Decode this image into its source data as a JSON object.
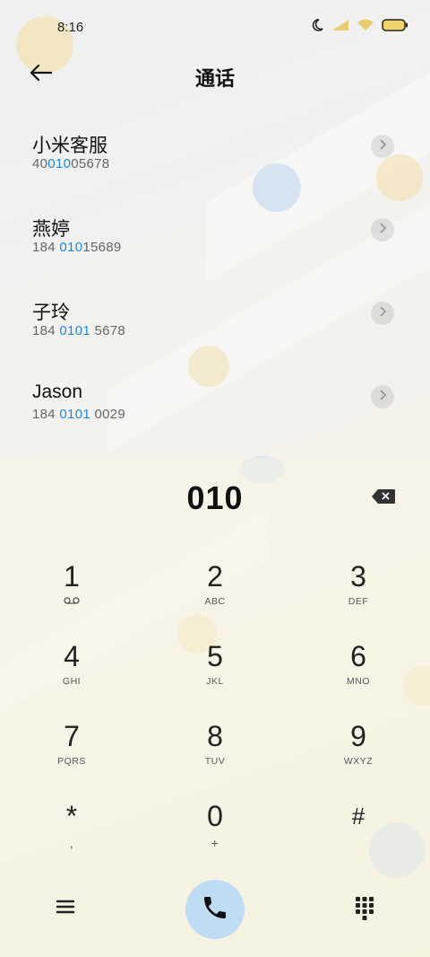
{
  "status_bar": {
    "time": "8:16"
  },
  "header": {
    "title": "通话"
  },
  "contacts": [
    {
      "name": "小米客服",
      "number_pre": "40",
      "number_hl": "010",
      "number_post": "05678"
    },
    {
      "name": "燕婷",
      "number_pre": "184 ",
      "number_hl": "010",
      "number_post": "15689"
    },
    {
      "name": "子玲",
      "number_pre": "184 ",
      "number_hl": "0101",
      "number_post": " 5678"
    },
    {
      "name": "Jason",
      "number_pre": "184 ",
      "number_hl": "0101",
      "number_post": " 0029"
    }
  ],
  "dialpad": {
    "entered_number": "010",
    "keys": [
      {
        "digit": "1",
        "letters": ""
      },
      {
        "digit": "2",
        "letters": "ABC"
      },
      {
        "digit": "3",
        "letters": "DEF"
      },
      {
        "digit": "4",
        "letters": "GHI"
      },
      {
        "digit": "5",
        "letters": "JKL"
      },
      {
        "digit": "6",
        "letters": "MNO"
      },
      {
        "digit": "7",
        "letters": "PQRS"
      },
      {
        "digit": "8",
        "letters": "TUV"
      },
      {
        "digit": "9",
        "letters": "WXYZ"
      },
      {
        "digit": "*",
        "letters": ","
      },
      {
        "digit": "0",
        "letters": "+"
      },
      {
        "digit": "#",
        "letters": ""
      }
    ]
  },
  "colors": {
    "highlight": "#1e88e5",
    "call_button": "#bfdcf5"
  },
  "icons": {
    "voicemail": "voicemail-icon",
    "back": "back-arrow-icon",
    "call": "phone-icon",
    "menu": "menu-icon",
    "keypad": "keypad-icon",
    "delete": "backspace-icon"
  }
}
